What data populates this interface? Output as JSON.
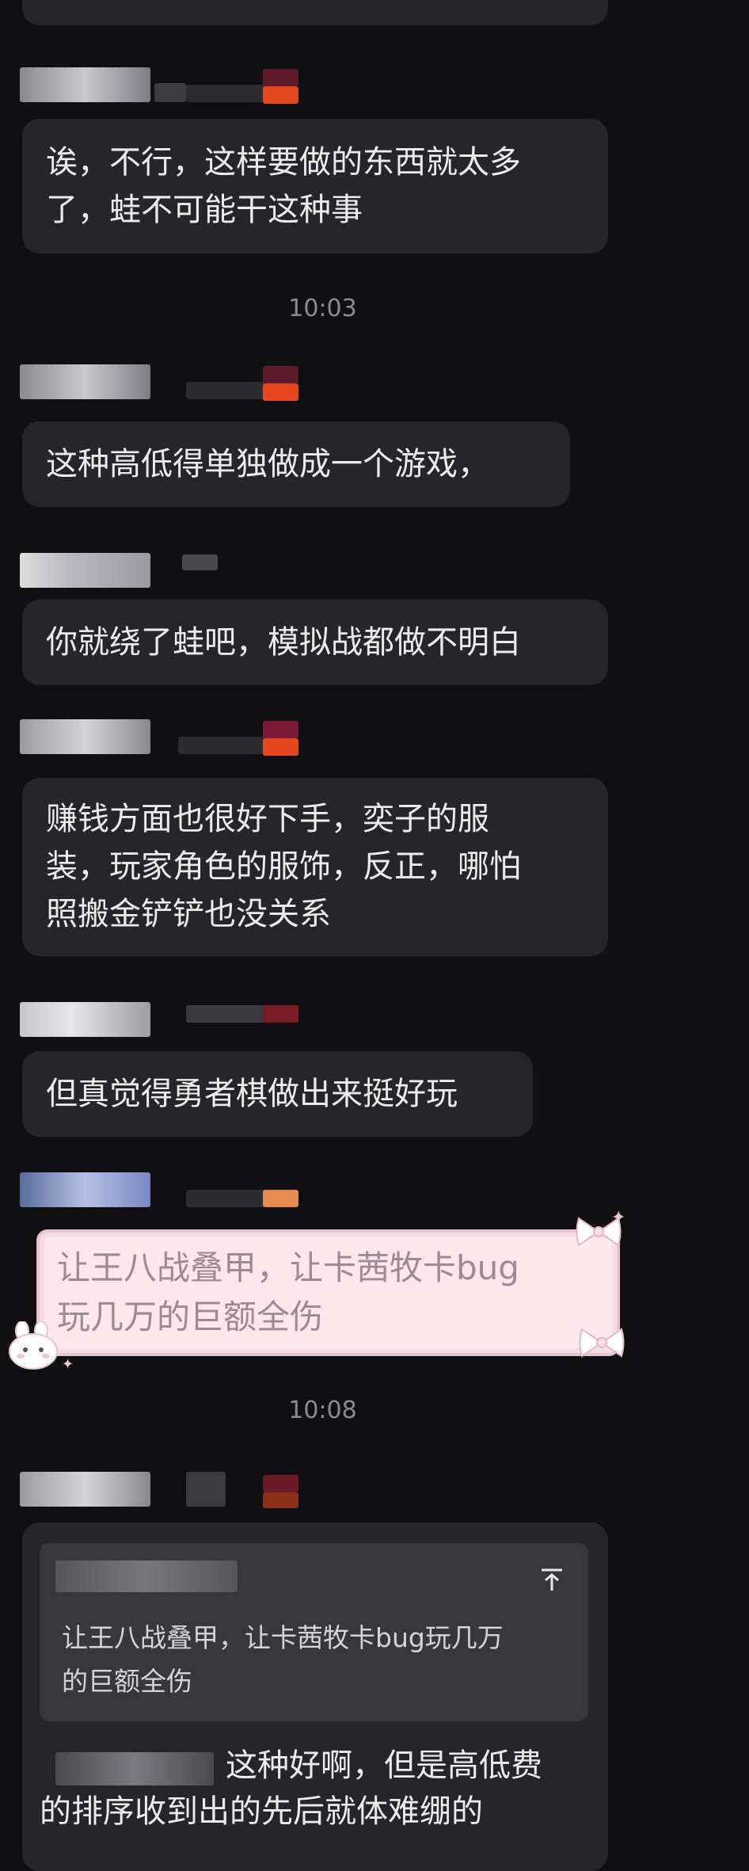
{
  "messages": [
    {
      "lines": [
        "诶，不行，这样要做的东西就太多",
        "了，蛙不可能干这种事"
      ]
    },
    {
      "lines": [
        "这种高低得单独做成一个游戏，"
      ]
    },
    {
      "lines": [
        "你就绕了蛙吧，模拟战都做不明白"
      ]
    },
    {
      "lines": [
        "赚钱方面也很好下手，奕子的服",
        "装，玩家角色的服饰，反正，哪怕",
        "照搬金铲铲也没关系"
      ]
    },
    {
      "lines": [
        "但真觉得勇者棋做出来挺好玩"
      ]
    },
    {
      "lines": [
        "让王八战叠甲，让卡茜牧卡bug",
        "玩几万的巨额全伤"
      ]
    },
    {
      "lines": [
        "这种好啊，但是高低费",
        "的排序收到出的先后就体难绷的"
      ]
    }
  ],
  "quote": {
    "lines": [
      "让王八战叠甲，让卡茜牧卡bug玩几万",
      "的巨额全伤"
    ],
    "expand_icon": "collapse-arrow-up"
  },
  "timestamps": [
    "10:03",
    "10:08"
  ]
}
